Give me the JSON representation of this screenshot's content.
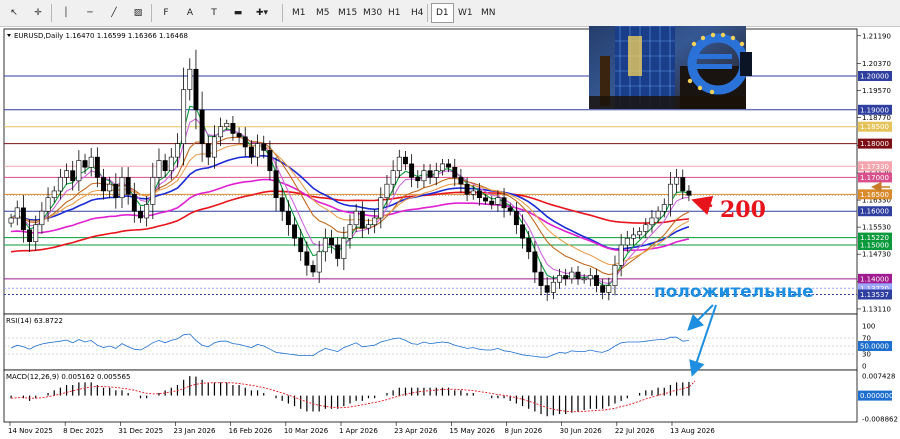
{
  "toolbar": {
    "tools": [
      {
        "name": "cursor-icon",
        "glyph": "↖"
      },
      {
        "name": "crosshair-icon",
        "glyph": "✛"
      },
      {
        "name": "vertical-line-icon",
        "glyph": "│"
      },
      {
        "name": "horizontal-line-icon",
        "glyph": "─"
      },
      {
        "name": "trendline-icon",
        "glyph": "╱"
      },
      {
        "name": "channel-icon",
        "glyph": "▨"
      },
      {
        "name": "fibonacci-icon",
        "glyph": "F"
      },
      {
        "name": "text-icon",
        "glyph": "A"
      },
      {
        "name": "label-icon",
        "glyph": "T"
      },
      {
        "name": "rectangle-icon",
        "glyph": "▬"
      },
      {
        "name": "shapes-icon",
        "glyph": "✚▾"
      }
    ],
    "timeframes": [
      "M1",
      "M5",
      "M15",
      "M30",
      "H1",
      "H4",
      "D1",
      "W1",
      "MN"
    ],
    "active_timeframe": "D1"
  },
  "chart_data": [
    {
      "type": "candlestick",
      "title": "EURUSD,Daily  1.16470 1.16599 1.16366 1.16468",
      "symbol": "EURUSD",
      "timeframe": "Daily",
      "ohlc_readout": {
        "open": 1.1647,
        "high": 1.16599,
        "low": 1.16366,
        "close": 1.16468
      },
      "x_tick_labels": [
        "14 Nov 2025",
        "8 Dec 2025",
        "31 Dec 2025",
        "23 Jan 2026",
        "16 Feb 2026",
        "10 Mar 2026",
        "1 Apr 2026",
        "23 Apr 2026",
        "15 May 2026",
        "8 Jun 2026",
        "30 Jun 2026",
        "22 Jul 2026",
        "13 Aug 2026"
      ],
      "y_tick_labels": [
        1.2119,
        1.2037,
        1.1957,
        1.1877,
        1.1795,
        1.1713,
        1.1633,
        1.1553,
        1.1473,
        1.1391,
        1.1311
      ],
      "ylim": [
        1.1296,
        1.2139
      ],
      "price_levels": [
        {
          "value": "1.20000",
          "color": "#2f3f9f"
        },
        {
          "value": "1.19000",
          "color": "#2f3f9f"
        },
        {
          "value": "1.18500",
          "color": "#e6c35a"
        },
        {
          "value": "1.18000",
          "color": "#7b0f14"
        },
        {
          "value": "1.17330",
          "color": "#f4a6ae"
        },
        {
          "value": "1.17000",
          "color": "#d94f8c"
        },
        {
          "value": "1.16500",
          "color": "#d98a2b"
        },
        {
          "value": "1.16000",
          "color": "#2f3f9f"
        },
        {
          "value": "1.15220",
          "color": "#0a9a3c"
        },
        {
          "value": "1.15000",
          "color": "#0a9a3c"
        },
        {
          "value": "1.14000",
          "color": "#9f1a8f"
        },
        {
          "value": "1.13720",
          "color": "#9aa6ff"
        },
        {
          "value": "1.13537",
          "color": "#2f3f9f"
        }
      ],
      "current_price": 1.16468,
      "moving_averages": [
        {
          "color": "#e8141c",
          "period_label": "200"
        },
        {
          "color": "#1a2bd6"
        },
        {
          "color": "#e020d0"
        },
        {
          "color": "#0a9a3c"
        },
        {
          "color": "#cc66dd"
        },
        {
          "color": "#c06a20"
        },
        {
          "color": "#e8a050"
        }
      ],
      "closes": [
        1.158,
        1.161,
        1.1545,
        1.151,
        1.156,
        1.16,
        1.164,
        1.166,
        1.17,
        1.172,
        1.169,
        1.175,
        1.173,
        1.176,
        1.17,
        1.166,
        1.168,
        1.164,
        1.17,
        1.165,
        1.16,
        1.158,
        1.162,
        1.17,
        1.175,
        1.172,
        1.176,
        1.18,
        1.196,
        1.202,
        1.19,
        1.18,
        1.176,
        1.182,
        1.185,
        1.186,
        1.183,
        1.182,
        1.179,
        1.176,
        1.18,
        1.178,
        1.172,
        1.164,
        1.16,
        1.156,
        1.152,
        1.148,
        1.144,
        1.142,
        1.148,
        1.152,
        1.15,
        1.146,
        1.152,
        1.156,
        1.16,
        1.155,
        1.156,
        1.158,
        1.164,
        1.168,
        1.172,
        1.176,
        1.174,
        1.17,
        1.169,
        1.172,
        1.17,
        1.172,
        1.174,
        1.173,
        1.17,
        1.168,
        1.165,
        1.166,
        1.164,
        1.163,
        1.162,
        1.164,
        1.161,
        1.16,
        1.156,
        1.152,
        1.148,
        1.142,
        1.138,
        1.136,
        1.139,
        1.141,
        1.14,
        1.142,
        1.14,
        1.14,
        1.141,
        1.138,
        1.136,
        1.138,
        1.144,
        1.15,
        1.152,
        1.153,
        1.154,
        1.156,
        1.158,
        1.16,
        1.162,
        1.168,
        1.17,
        1.166,
        1.1647
      ],
      "candle_up_color": "#ffffff",
      "candle_down_color": "#000000"
    },
    {
      "type": "line",
      "title": "RSI(14) 63.8722",
      "indicator": "RSI",
      "period": 14,
      "current_value": 63.8722,
      "y_tick_labels": [
        "100",
        "70",
        "50.0000",
        "30",
        "0"
      ],
      "ylim": [
        0,
        100
      ],
      "levels": [
        70,
        50,
        30
      ],
      "values": [
        45,
        52,
        48,
        42,
        50,
        55,
        58,
        60,
        62,
        65,
        58,
        66,
        60,
        64,
        52,
        46,
        50,
        44,
        56,
        48,
        42,
        40,
        48,
        58,
        64,
        58,
        64,
        68,
        78,
        80,
        64,
        52,
        48,
        58,
        62,
        62,
        56,
        54,
        50,
        46,
        54,
        50,
        42,
        34,
        32,
        30,
        28,
        26,
        26,
        26,
        36,
        44,
        40,
        36,
        46,
        52,
        58,
        48,
        50,
        52,
        60,
        64,
        68,
        70,
        64,
        56,
        54,
        60,
        56,
        58,
        60,
        58,
        52,
        48,
        44,
        46,
        42,
        40,
        40,
        44,
        38,
        36,
        32,
        28,
        26,
        24,
        22,
        22,
        28,
        34,
        32,
        38,
        36,
        36,
        40,
        36,
        34,
        40,
        50,
        58,
        60,
        60,
        60,
        62,
        64,
        66,
        66,
        72,
        72,
        62,
        63.8722
      ],
      "line_color": "#1e6fd0"
    },
    {
      "type": "bar",
      "title": "MACD(12,26,9) 0.005162 0.005565",
      "indicator": "MACD",
      "params": "12,26,9",
      "macd_value": 0.005162,
      "signal_value": 0.005565,
      "y_tick_labels": [
        "0.007428",
        "0.000000",
        "-0.008862"
      ],
      "ylim": [
        -0.008862,
        0.007428
      ],
      "histogram": [
        -0.001,
        0.0,
        -0.001,
        -0.002,
        -0.001,
        0.0,
        0.001,
        0.002,
        0.003,
        0.004,
        0.004,
        0.005,
        0.005,
        0.005,
        0.004,
        0.003,
        0.003,
        0.002,
        0.002,
        0.001,
        0.0,
        -0.001,
        -0.001,
        0.0,
        0.001,
        0.002,
        0.003,
        0.004,
        0.006,
        0.0074,
        0.0072,
        0.006,
        0.005,
        0.005,
        0.005,
        0.005,
        0.004,
        0.004,
        0.003,
        0.002,
        0.002,
        0.001,
        0.0,
        -0.001,
        -0.002,
        -0.003,
        -0.004,
        -0.005,
        -0.006,
        -0.006,
        -0.006,
        -0.005,
        -0.005,
        -0.005,
        -0.004,
        -0.003,
        -0.002,
        -0.002,
        -0.001,
        -0.001,
        0.0,
        0.001,
        0.002,
        0.003,
        0.003,
        0.003,
        0.003,
        0.003,
        0.003,
        0.003,
        0.003,
        0.003,
        0.002,
        0.002,
        0.001,
        0.001,
        0.0,
        0.0,
        -0.001,
        -0.001,
        -0.001,
        -0.002,
        -0.003,
        -0.004,
        -0.005,
        -0.006,
        -0.007,
        -0.0078,
        -0.0075,
        -0.007,
        -0.007,
        -0.0065,
        -0.006,
        -0.0055,
        -0.005,
        -0.005,
        -0.005,
        -0.004,
        -0.003,
        -0.002,
        -0.001,
        0.0,
        0.001,
        0.002,
        0.002,
        0.003,
        0.003,
        0.004,
        0.005,
        0.005,
        0.0052
      ],
      "signal": [
        -0.001,
        -0.0008,
        -0.0008,
        -0.001,
        -0.001,
        -0.0008,
        -0.0004,
        0.0,
        0.0006,
        0.0012,
        0.0018,
        0.0024,
        0.0029,
        0.0033,
        0.0035,
        0.0034,
        0.0033,
        0.0031,
        0.0028,
        0.0025,
        0.002,
        0.0014,
        0.0009,
        0.0007,
        0.0007,
        0.001,
        0.0014,
        0.0019,
        0.0027,
        0.0036,
        0.0043,
        0.0047,
        0.0048,
        0.0049,
        0.0049,
        0.0049,
        0.0048,
        0.0046,
        0.0043,
        0.0039,
        0.0035,
        0.003,
        0.0024,
        0.0017,
        0.001,
        0.0002,
        -0.0006,
        -0.0015,
        -0.0024,
        -0.0031,
        -0.0037,
        -0.0041,
        -0.0044,
        -0.0046,
        -0.0046,
        -0.0043,
        -0.0039,
        -0.0035,
        -0.003,
        -0.0026,
        -0.0021,
        -0.0015,
        -0.0008,
        -0.0001,
        0.0005,
        0.001,
        0.0014,
        0.0017,
        0.0019,
        0.0021,
        0.0023,
        0.0024,
        0.0024,
        0.0023,
        0.0021,
        0.0019,
        0.0015,
        0.0012,
        0.0008,
        0.0004,
        0.0001,
        -0.0003,
        -0.0008,
        -0.0014,
        -0.0021,
        -0.0029,
        -0.0037,
        -0.0046,
        -0.0052,
        -0.0056,
        -0.0059,
        -0.0061,
        -0.0061,
        -0.006,
        -0.0058,
        -0.0056,
        -0.0055,
        -0.0052,
        -0.0048,
        -0.0042,
        -0.0036,
        -0.0029,
        -0.0021,
        -0.0013,
        -0.0006,
        0.0001,
        0.0007,
        0.0014,
        0.0021,
        0.0027,
        0.0032,
        0.0056
      ],
      "hist_color": "#000000",
      "signal_color": "#e8141c"
    }
  ],
  "annotations": {
    "ma_label": "200",
    "positive_label": "положительные"
  },
  "photo": {
    "description_icon": "ecb-euro-sign-photo",
    "euro_color": "#2a72d8"
  }
}
